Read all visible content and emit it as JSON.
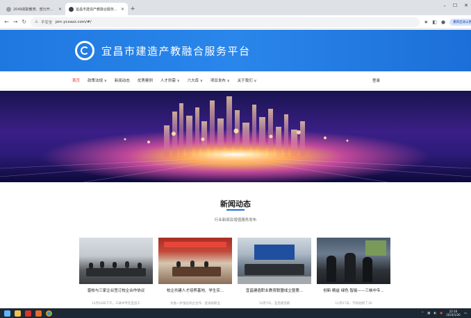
{
  "browser": {
    "tabs": [
      {
        "title": "2049高职教育、部分开放课程网",
        "active": false
      },
      {
        "title": "宜昌市建造产教融合服务平台",
        "active": true
      }
    ],
    "new_tab": "+",
    "window_controls": [
      "–",
      "☐",
      "✕"
    ],
    "security_label": "不安全",
    "url": "jzm.ycxazz.com/#/",
    "profile_button": "重新启动以更新"
  },
  "site": {
    "title": "宜昌市建造产教融合服务平台",
    "nav": [
      {
        "label": "首页",
        "current": true
      },
      {
        "label": "政策法规 ∨",
        "current": false
      },
      {
        "label": "新闻动态",
        "current": false
      },
      {
        "label": "优秀案例",
        "current": false
      },
      {
        "label": "人才供需 ∨",
        "current": false
      },
      {
        "label": "六大库 ∨",
        "current": false
      },
      {
        "label": "项目发布 ∨",
        "current": false
      },
      {
        "label": "关于我们 ∨",
        "current": false
      }
    ],
    "login": "登录",
    "colors": {
      "brand": "#1f78e0",
      "accent": "#e0322a"
    }
  },
  "news": {
    "title": "新闻动态",
    "subtitle": "行业新闻及增值服务发布",
    "cards": [
      {
        "title": "晋校与三家企业签订校企合作协议",
        "desc": "12月18日下午，三峡中专在宜昌工"
      },
      {
        "title": "校企共建人才培养基地、学生实...",
        "desc": "为进一步强化校企合作、促进就职业"
      },
      {
        "title": "宜昌建造职业教育联盟成立暨第...",
        "desc": "12月7日，宜昌建造职"
      },
      {
        "title": "创新 精益 绿色 智能——三峡中专...",
        "desc": "11月27日，学校组织了30"
      }
    ]
  },
  "taskbar": {
    "time": "22:16",
    "date": "2024/1/26"
  }
}
